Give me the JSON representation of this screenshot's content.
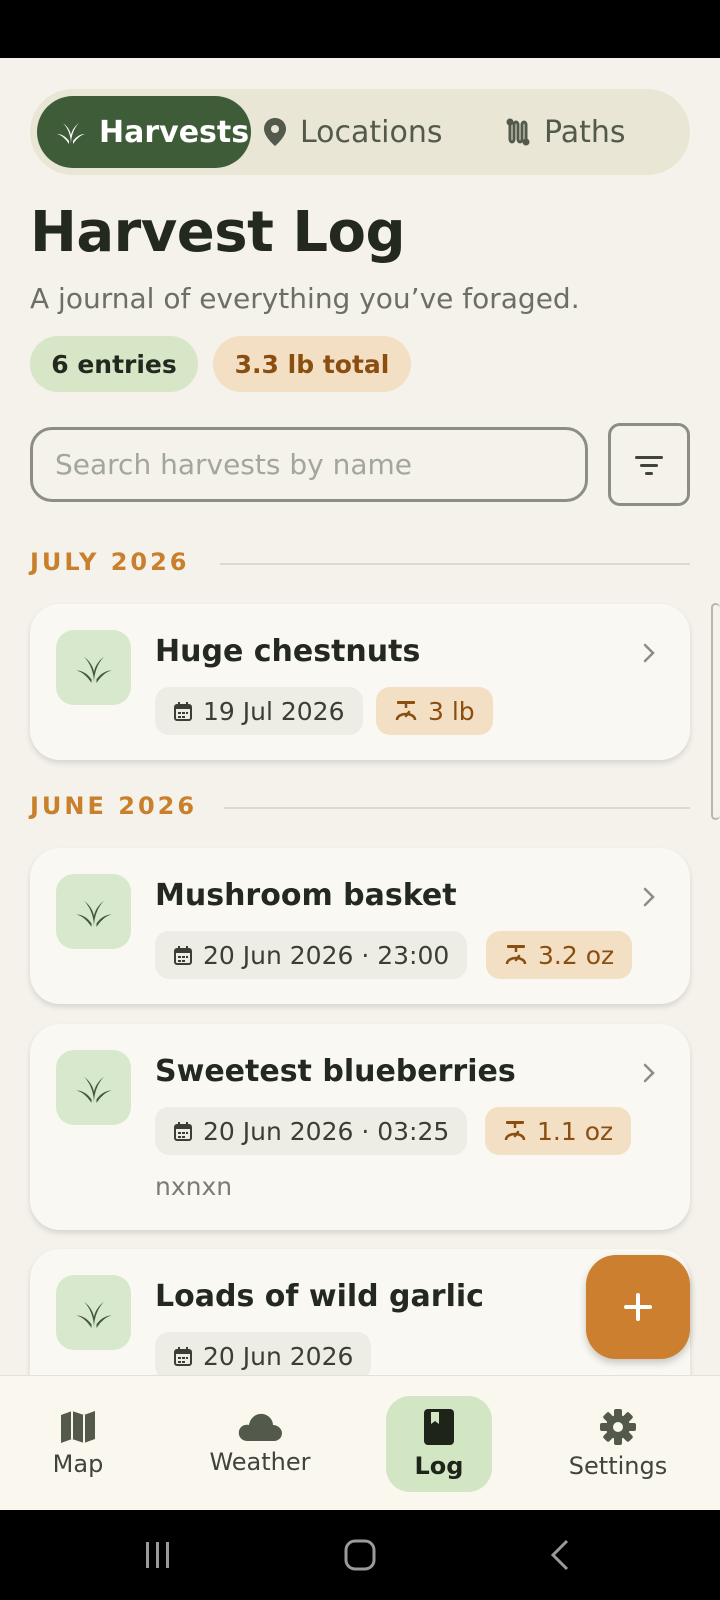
{
  "tabs": [
    {
      "label": "Harvests",
      "icon": "sprout-icon",
      "active": true
    },
    {
      "label": "Locations",
      "icon": "location-pin-icon",
      "active": false
    },
    {
      "label": "Paths",
      "icon": "route-icon",
      "active": false
    }
  ],
  "header": {
    "title": "Harvest Log",
    "subtitle": "A journal of everything you’ve foraged."
  },
  "summary": {
    "entries": "6 entries",
    "total": "3.3 lb total"
  },
  "search": {
    "placeholder": "Search harvests by name",
    "value": ""
  },
  "sections": [
    {
      "heading": "JULY 2026",
      "items": [
        {
          "title": "Huge chestnuts",
          "date": "19 Jul 2026",
          "weight": "3 lb",
          "note": ""
        }
      ]
    },
    {
      "heading": "JUNE 2026",
      "items": [
        {
          "title": "Mushroom basket",
          "date": "20 Jun 2026 · 23:00",
          "weight": "3.2 oz",
          "note": ""
        },
        {
          "title": "Sweetest blueberries",
          "date": "20 Jun 2026 · 03:25",
          "weight": "1.1 oz",
          "note": "nxnxn"
        },
        {
          "title": "Loads of wild garlic",
          "date": "20 Jun 2026",
          "weight": "",
          "note": ""
        }
      ]
    }
  ],
  "fab": {
    "label": "+"
  },
  "bottom_nav": [
    {
      "label": "Map",
      "icon": "map-icon",
      "active": false
    },
    {
      "label": "Weather",
      "icon": "cloud-icon",
      "active": false
    },
    {
      "label": "Log",
      "icon": "book-icon",
      "active": true
    },
    {
      "label": "Settings",
      "icon": "gear-icon",
      "active": false
    }
  ],
  "colors": {
    "accent_green": "#3f5c38",
    "accent_orange": "#cc7f2e",
    "background": "#f4f2ea"
  }
}
